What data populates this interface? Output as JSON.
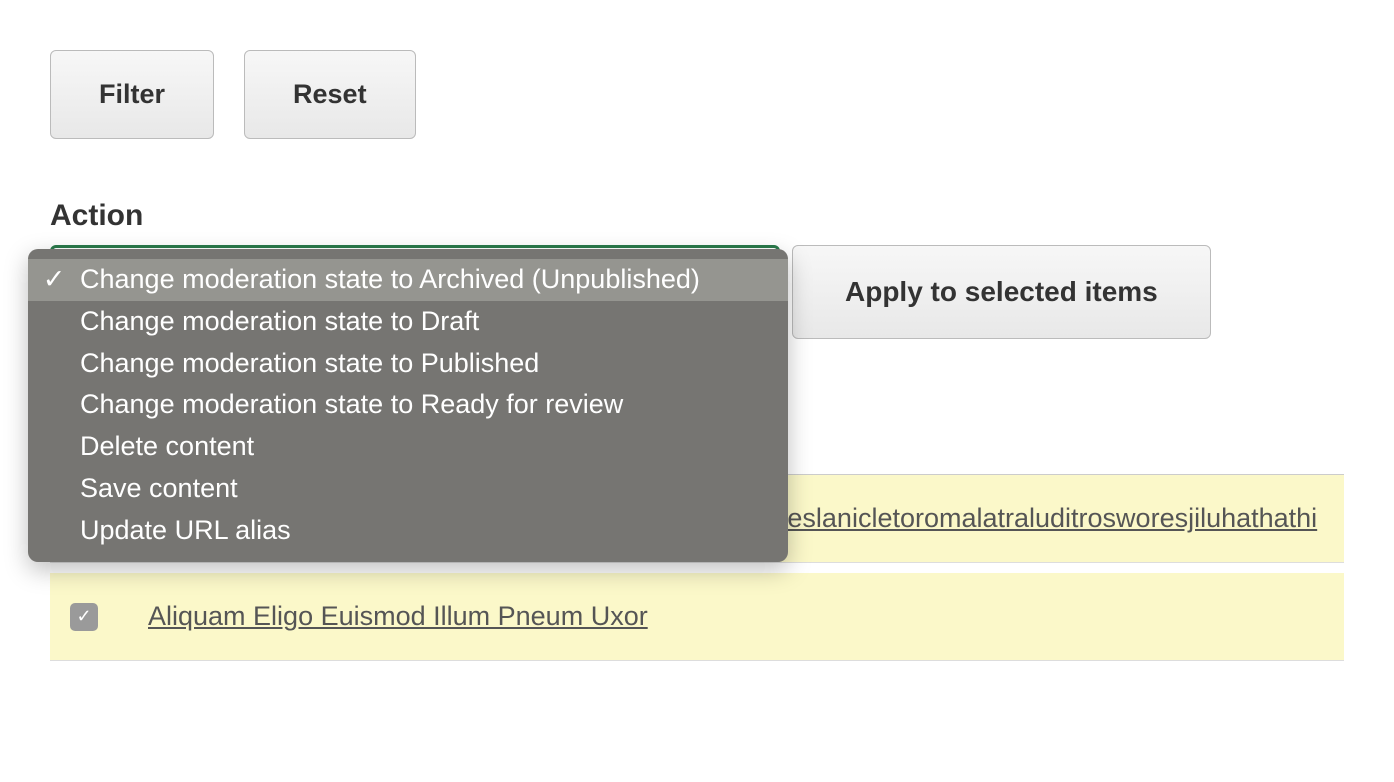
{
  "buttons": {
    "filter": "Filter",
    "reset": "Reset",
    "apply": "Apply to selected items"
  },
  "action": {
    "label": "Action",
    "options": [
      "Change moderation state to Archived (Unpublished)",
      "Change moderation state to Draft",
      "Change moderation state to Published",
      "Change moderation state to Ready for review",
      "Delete content",
      "Save content",
      "Update URL alias"
    ],
    "selected_index": 0
  },
  "rows": [
    {
      "checked": true,
      "title": "cripnitrolidowedriviguswunupophadakiwustapauedropeslanicletoromalatraluditrosworesjiluhathathi"
    },
    {
      "checked": true,
      "title": "Aliquam Eligo Euismod Illum Pneum Uxor"
    }
  ],
  "icons": {
    "check": "✓"
  }
}
